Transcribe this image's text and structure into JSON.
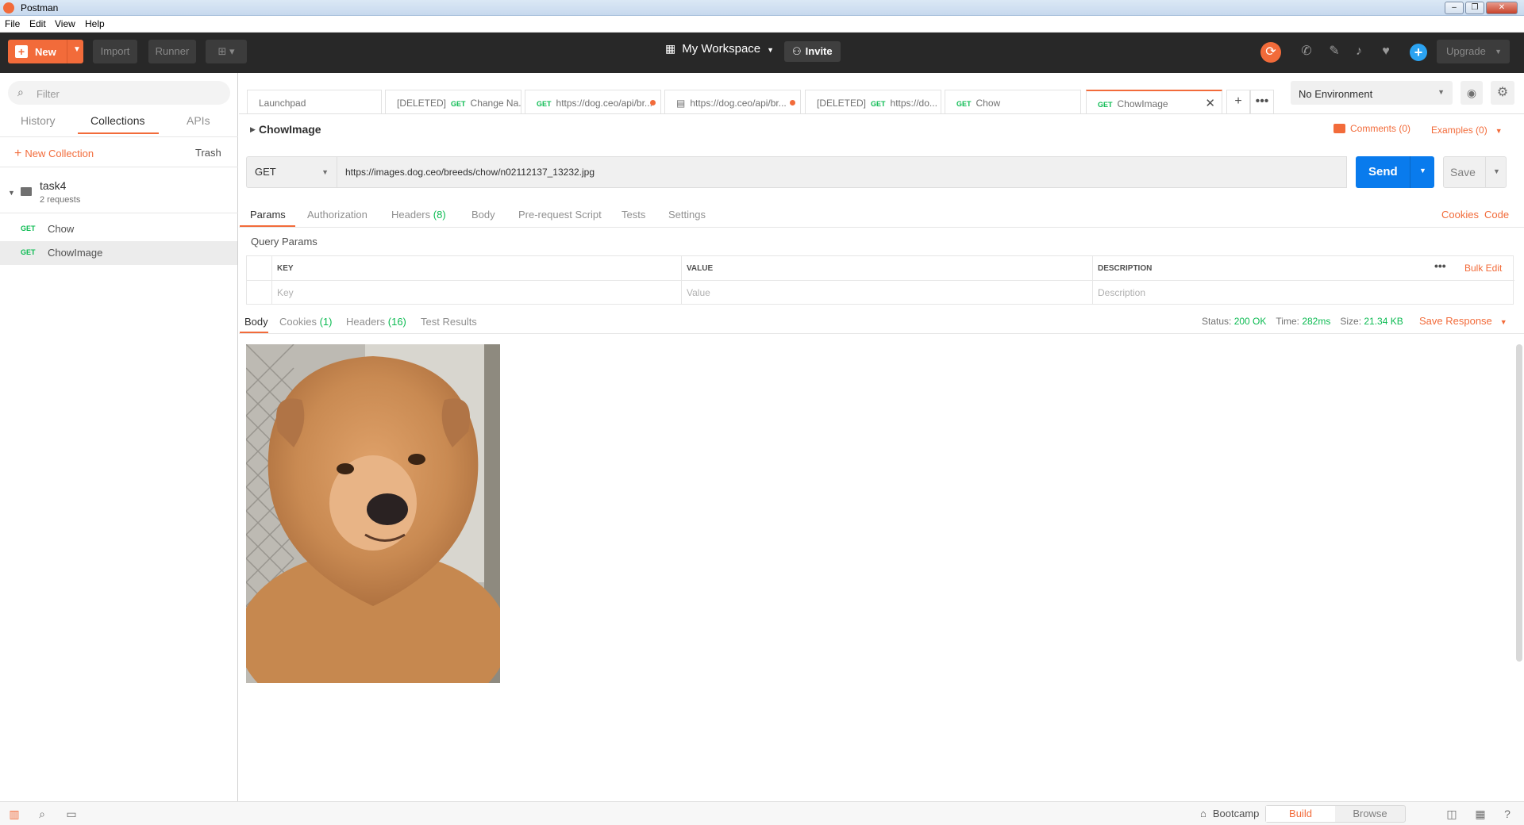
{
  "window": {
    "title": "Postman",
    "menu": [
      "File",
      "Edit",
      "View",
      "Help"
    ],
    "controls": {
      "minimize": "–",
      "maximize": "❐",
      "close": "✕"
    }
  },
  "header": {
    "new_label": "New",
    "import_label": "Import",
    "runner_label": "Runner",
    "workspace_label": "My Workspace",
    "invite_label": "Invite",
    "upgrade_label": "Upgrade",
    "accent_color": "#f26b3a"
  },
  "sidebar": {
    "filter_placeholder": "Filter",
    "tabs": [
      "History",
      "Collections",
      "APIs"
    ],
    "active_tab": "Collections",
    "new_collection_label": "New Collection",
    "trash_label": "Trash",
    "collection": {
      "name": "task4",
      "count_label": "2 requests",
      "requests": [
        {
          "method": "GET",
          "name": "Chow"
        },
        {
          "method": "GET",
          "name": "ChowImage"
        }
      ]
    }
  },
  "tabs": [
    {
      "prefix": "",
      "method": "",
      "label": "Launchpad"
    },
    {
      "prefix": "[DELETED]",
      "method": "GET",
      "label": "Change Na..."
    },
    {
      "prefix": "",
      "method": "GET",
      "label": "https://dog.ceo/api/br...",
      "unsaved": true
    },
    {
      "prefix": "",
      "method": "",
      "label": "https://dog.ceo/api/br...",
      "unsaved": true
    },
    {
      "prefix": "[DELETED]",
      "method": "GET",
      "label": "https://do..."
    },
    {
      "prefix": "",
      "method": "GET",
      "label": "Chow"
    },
    {
      "prefix": "",
      "method": "GET",
      "label": "ChowImage",
      "active": true
    }
  ],
  "environment": {
    "selected": "No Environment"
  },
  "request": {
    "title": "ChowImage",
    "comments_label": "Comments (0)",
    "examples_label": "Examples (0)",
    "method": "GET",
    "url": "https://images.dog.ceo/breeds/chow/n02112137_13232.jpg",
    "send_label": "Send",
    "save_label": "Save",
    "tabs": {
      "params": "Params",
      "authorization": "Authorization",
      "headers": "Headers",
      "headers_count": "(8)",
      "body": "Body",
      "prerequest": "Pre-request Script",
      "tests": "Tests",
      "settings": "Settings"
    },
    "cookies_link": "Cookies",
    "code_link": "Code",
    "query_params_title": "Query Params",
    "params_table": {
      "headers": [
        "KEY",
        "VALUE",
        "DESCRIPTION"
      ],
      "placeholders": {
        "key": "Key",
        "value": "Value",
        "description": "Description"
      },
      "bulk_edit_label": "Bulk Edit"
    }
  },
  "response": {
    "tabs": {
      "body": "Body",
      "cookies": "Cookies",
      "cookies_count": "(1)",
      "headers": "Headers",
      "headers_count": "(16)",
      "test_results": "Test Results"
    },
    "status_label": "Status:",
    "status_value": "200 OK",
    "time_label": "Time:",
    "time_value": "282ms",
    "size_label": "Size:",
    "size_value": "21.34 KB",
    "save_response_label": "Save Response"
  },
  "footer": {
    "bootcamp_label": "Bootcamp",
    "build_label": "Build",
    "browse_label": "Browse"
  }
}
